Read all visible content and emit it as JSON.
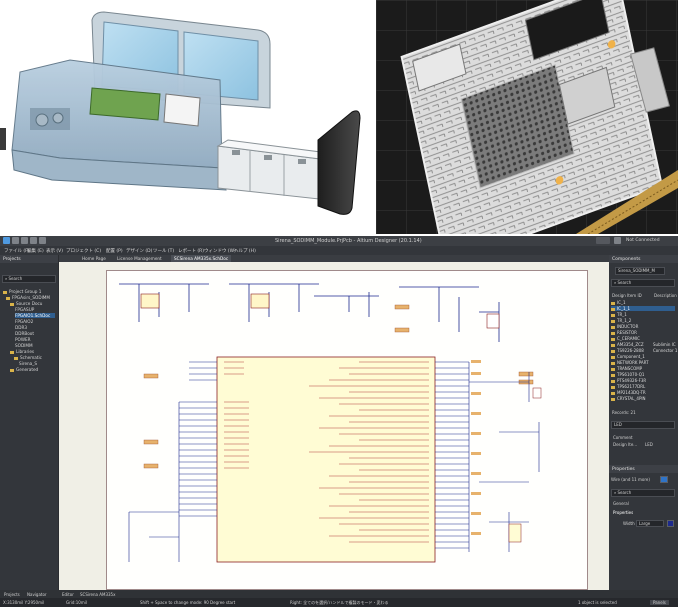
{
  "window": {
    "title": "Sirena_SODIMM_Module.PrjPcb - Altium Designer (20.1.14)",
    "not_connected": "Not Connected"
  },
  "menu": [
    "ファイル (F)",
    "編集 (E)",
    "表示 (V)",
    "プロジェクト (C)",
    "配置 (P)",
    "デザイン (D)",
    "ツール (T)",
    "レポート (R)",
    "ウィンドウ (W)",
    "ヘルプ (H)"
  ],
  "projects_panel": {
    "title": "Projects",
    "search_placeholder": "Search",
    "tree": [
      {
        "label": "Project Group 1"
      },
      {
        "label": "FPGAsirs_SODIMM"
      },
      {
        "label": "Source Docu"
      },
      {
        "label": "FPGASUP"
      },
      {
        "label": "FPGAIO1.SchDoc"
      },
      {
        "label": "FPGAIO2"
      },
      {
        "label": "DDR3"
      },
      {
        "label": "DDRBoot"
      },
      {
        "label": "POWER"
      },
      {
        "label": "SODIMM"
      },
      {
        "label": "Libraries"
      },
      {
        "label": "Schematic"
      },
      {
        "label": "Sirena_S"
      },
      {
        "label": "Generated"
      }
    ]
  },
  "doc_tabs": [
    "Home Page",
    "License Management",
    "SCSirena AM335x.SchDoc"
  ],
  "components_panel": {
    "title": "Components",
    "selector_value": "Sirena_SODIMM_M",
    "search_placeholder": "Search",
    "col_design_item": "Design Item ID",
    "col_description": "Description",
    "items": [
      "IC_1",
      "IC_1_1",
      "TR_1",
      "TR_1_2",
      "INDUCTOR",
      "RESISTOR",
      "C_CERAMIC",
      "AM3354_ZCZ",
      "TS9226-2808",
      "Component_1",
      "NETWORK PART",
      "TRANSCOMP",
      "TPS61070-Q1",
      "PTS49326-F3R",
      "TPS62177DRL",
      "MP2143DQ-TR",
      "CRYSTAL_4PIN"
    ],
    "descriptions": {
      "AM3354_ZCZ": "Sublimin IC",
      "TS9226-2808": "Connector 1"
    },
    "records": "Records: 21",
    "filter_value": "LED",
    "comment_label": "Comment",
    "design_label": "Design Ite...",
    "design_value": "LED"
  },
  "properties_panel": {
    "title": "Properties",
    "filter_text": "Wire  (and 11 more)",
    "search_placeholder": "Search",
    "section_general": "General",
    "section_properties": "Properties",
    "width_label": "Width",
    "width_value": "Large",
    "color_hex": "#1d2a8e"
  },
  "bottom_tabs": {
    "left": [
      "Projects",
      "Navigator"
    ],
    "editor": "Editor",
    "doc": "SCSirena AM335x"
  },
  "status": {
    "coords": "X:3130mil Y:2950mil",
    "grid": "Grid:10mil",
    "hint_left": "Shift + Space to change mode: 90 Degree start",
    "hint_mid": "Right: 全てのを選択/ハンドルで複製のモード・変わる",
    "selected": "1 object is selected",
    "panels": "Panels"
  },
  "schematic": {
    "ic_pins_left": [
      "SD0_CLK",
      "SD0_CMD",
      "GPMC_A0",
      "GPMC_A1",
      "GPMC_A2",
      "GPMC_A3",
      "GPMC_A4",
      "GPMC_A5",
      "GPMC_A6",
      "GPMC_A7",
      "GPMC_A8",
      "GPMC_A9",
      "GPMC_A10",
      "GPMC_A11",
      "LCD_DATA0",
      "LCD_DATA1",
      "LCD_DATA2",
      "LCD_DATA3",
      "LCD_DATA4",
      "LCD_DATA5"
    ],
    "ic_pins_right": [
      "MMC0_DAT0",
      "MMC0_DAT1",
      "MMC0_DAT2",
      "MMC0_DAT3",
      "UART0_RX",
      "UART0_TX",
      "I2C0_SDA",
      "I2C0_SCL",
      "SPI0_CLK",
      "SPI0_D0",
      "SPI0_D1",
      "SPI0_CS0",
      "MCASP0_AXR0",
      "MCASP0_FSX"
    ]
  }
}
